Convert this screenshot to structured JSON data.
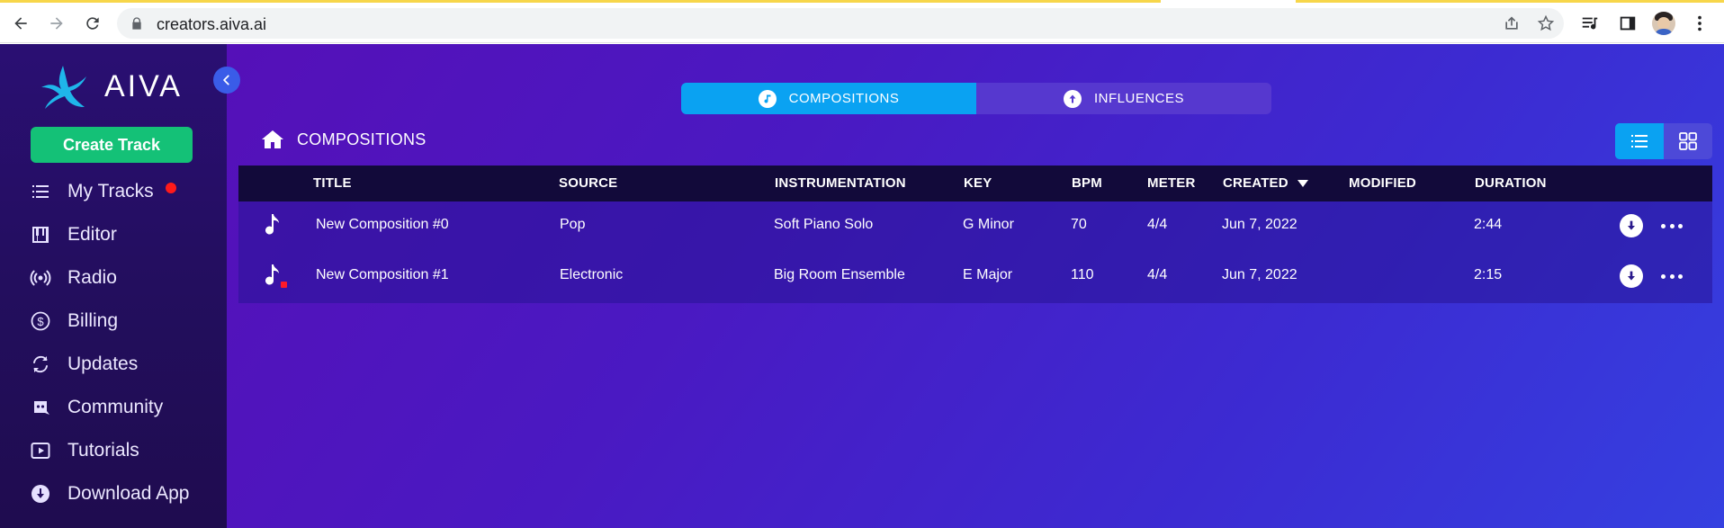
{
  "browser": {
    "url": "creators.aiva.ai"
  },
  "sidebar": {
    "brand": "AIVA",
    "create_button": "Create Track",
    "items": [
      {
        "label": "My Tracks",
        "icon": "list-icon",
        "badge": true
      },
      {
        "label": "Editor",
        "icon": "piano-icon"
      },
      {
        "label": "Radio",
        "icon": "radio-icon"
      },
      {
        "label": "Billing",
        "icon": "dollar-icon"
      },
      {
        "label": "Updates",
        "icon": "refresh-icon"
      },
      {
        "label": "Community",
        "icon": "discord-icon"
      },
      {
        "label": "Tutorials",
        "icon": "play-icon"
      },
      {
        "label": "Download App",
        "icon": "download-icon"
      }
    ]
  },
  "tabs": [
    {
      "label": "COMPOSITIONS",
      "active": true,
      "icon": "music-note-icon"
    },
    {
      "label": "INFLUENCES",
      "active": false,
      "icon": "upload-arrow-icon"
    }
  ],
  "breadcrumb": {
    "label": "COMPOSITIONS"
  },
  "table": {
    "headers": [
      "TITLE",
      "SOURCE",
      "INSTRUMENTATION",
      "KEY",
      "BPM",
      "METER",
      "CREATED",
      "MODIFIED",
      "DURATION"
    ],
    "rows": [
      {
        "title": "New Composition #0",
        "source": "Pop",
        "instrumentation": "Soft Piano Solo",
        "key": "G Minor",
        "bpm": "70",
        "meter": "4/4",
        "created": "Jun 7, 2022",
        "modified": "",
        "duration": "2:44",
        "new": false
      },
      {
        "title": "New Composition #1",
        "source": "Electronic",
        "instrumentation": "Big Room Ensemble",
        "key": "E Major",
        "bpm": "110",
        "meter": "4/4",
        "created": "Jun 7, 2022",
        "modified": "",
        "duration": "2:15",
        "new": true
      }
    ]
  },
  "colors": {
    "accent": "#0aa2f2",
    "create_button": "#14c177",
    "badge": "#ff1a1a"
  }
}
